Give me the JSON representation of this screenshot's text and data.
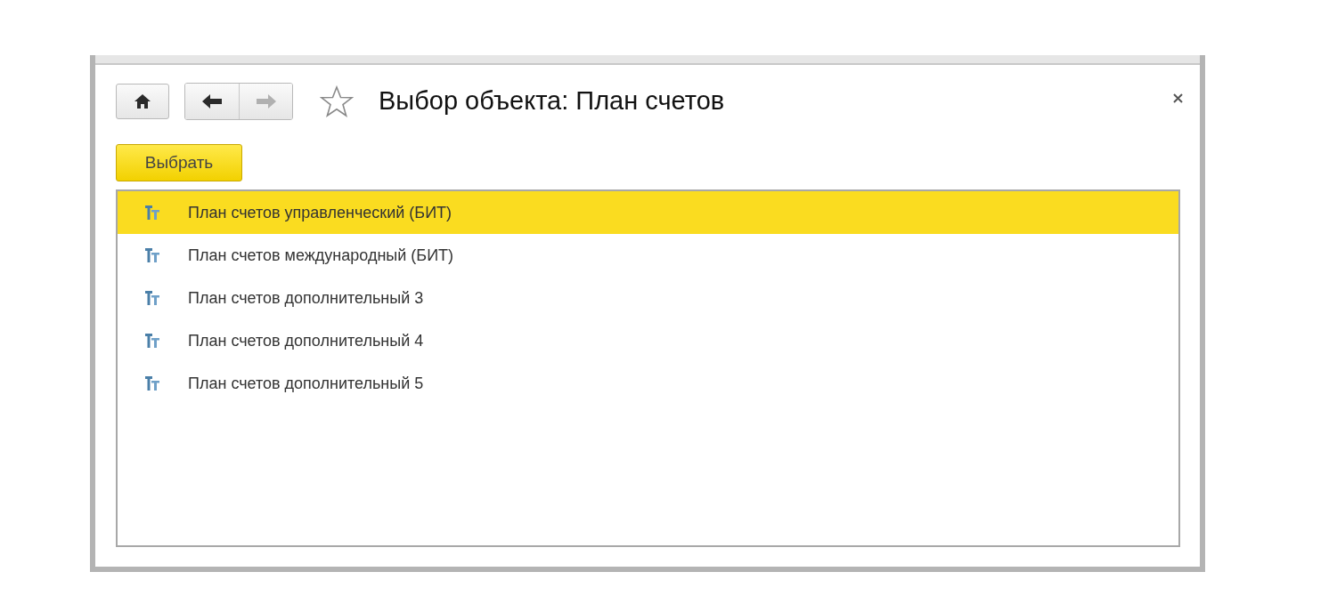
{
  "window": {
    "title": "Выбор объекта: План счетов"
  },
  "nav": [
    {
      "kind": "home",
      "disabled": false
    },
    {
      "kind": "back",
      "disabled": false
    },
    {
      "kind": "forward",
      "disabled": true
    }
  ],
  "favorite": {
    "on": false
  },
  "toolbar": {
    "choose_button": "Выбрать"
  },
  "list": {
    "rows": [
      {
        "text": "План счетов управленческий (БИТ)",
        "selected": true
      },
      {
        "text": "План счетов международный (БИТ)",
        "selected": false
      },
      {
        "text": "План счетов дополнительный 3",
        "selected": false
      },
      {
        "text": "План счетов дополнительный 4",
        "selected": false
      },
      {
        "text": "План счетов дополнительный 5",
        "selected": false
      }
    ]
  }
}
